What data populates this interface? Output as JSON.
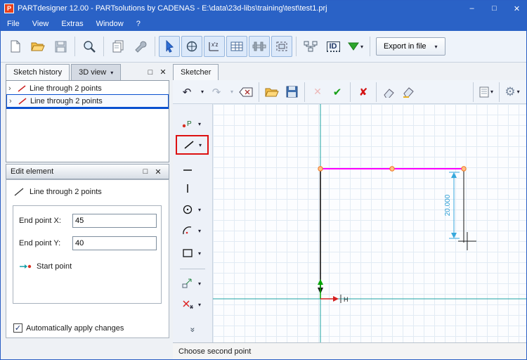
{
  "window": {
    "title": "PARTdesigner 12.00 - PARTsolutions by CADENAS - E:\\data\\23d-libs\\training\\test\\test1.prj"
  },
  "icons": {
    "app_logo": "P",
    "minimize": "–",
    "maximize": "□",
    "close": "✕",
    "dropdown": "▾",
    "undo": "↶",
    "redo": "↷",
    "check_green": "✔",
    "cross_red": "✘",
    "cross_pale": "✕",
    "gear": "⚙",
    "more_chevron": "»",
    "expander": "›",
    "checkbox_check": "✓",
    "xz_label": "x'z",
    "point_label": "P",
    "h_marker": "H"
  },
  "menu": {
    "items": [
      {
        "label": "File"
      },
      {
        "label": "View"
      },
      {
        "label": "Extras"
      },
      {
        "label": "Window"
      },
      {
        "label": "?"
      }
    ]
  },
  "main_toolbar": {
    "id_label": "ID",
    "export_label": "Export in file"
  },
  "history_panel": {
    "tabs": [
      {
        "label": "Sketch history"
      },
      {
        "label": "3D view"
      }
    ],
    "items": [
      {
        "label": "Line through 2 points"
      },
      {
        "label": "Line through 2 points"
      }
    ]
  },
  "edit_panel": {
    "title": "Edit element",
    "element_label": "Line through 2 points",
    "fields": [
      {
        "label": "End point X:",
        "value": "45"
      },
      {
        "label": "End point Y:",
        "value": "40"
      }
    ],
    "start_point_label": "Start point",
    "auto_apply_label": "Automatically apply changes",
    "auto_apply_checked": true
  },
  "sketcher": {
    "tab_label": "Sketcher",
    "status_text": "Choose second point",
    "dimension_label": "20.000"
  },
  "colors": {
    "titlebar": "#2a62c6",
    "selection": "#0a50d0",
    "active_tool_border": "#dd1111",
    "current_line": "#ff00ff",
    "axis": "#1fa3a3",
    "dimension": "#35a8dc",
    "point_fill": "#ffc08a",
    "point_stroke": "#f07820"
  }
}
